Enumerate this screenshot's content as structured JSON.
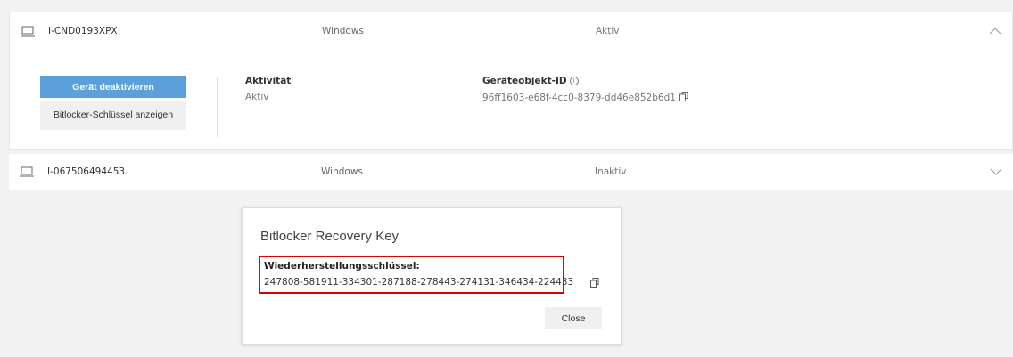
{
  "devices": [
    {
      "name": "I-CND0193XPX",
      "os": "Windows",
      "status": "Aktiv",
      "expanded": true,
      "actions": {
        "deactivate_label": "Gerät deaktivieren",
        "bitlocker_label": "Bitlocker-Schlüssel anzeigen"
      },
      "fields": {
        "activity_label": "Aktivität",
        "activity_value": "Aktiv",
        "object_id_label": "Geräteobjekt-ID",
        "object_id_value": "96ff1603-e68f-4cc0-8379-dd46e852b6d1"
      }
    },
    {
      "name": "I-067506494453",
      "os": "Windows",
      "status": "Inaktiv",
      "expanded": false
    }
  ],
  "dialog": {
    "title": "Bitlocker Recovery Key",
    "key_label": "Wiederherstellungsschlüssel:",
    "key_value": "247808-581911-334301-287188-278443-274131-346434-224433",
    "close_label": "Close"
  },
  "colors": {
    "primary_button": "#5ba0db",
    "highlight_border": "#e00000",
    "background": "#f2f2f2"
  },
  "icons": {
    "device": "laptop-icon",
    "info": "info-icon",
    "copy": "copy-icon",
    "expand": "chevron-down-icon",
    "collapse": "chevron-up-icon"
  }
}
